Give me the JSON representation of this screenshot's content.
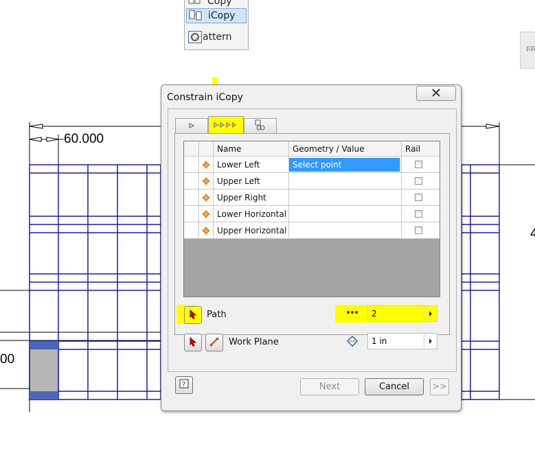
{
  "context_menu": {
    "items": [
      {
        "label": "Copy",
        "icon": "copy-icon"
      },
      {
        "label": "iCopy",
        "icon": "icopy-icon",
        "selected": true
      },
      {
        "label": "attern",
        "icon": "pattern-icon"
      }
    ]
  },
  "badge": {
    "text": "FR"
  },
  "drawing": {
    "dimension_label": "60.000",
    "dimension_label_partial_left": "00",
    "dimension_label_partial_right": "4",
    "line_color": "#1b1b9e"
  },
  "dialog": {
    "title": "Constrain iCopy",
    "tabs": [
      {
        "name": "tab-start",
        "icon": "start-point-icon"
      },
      {
        "name": "tab-path",
        "icon": "path-points-icon",
        "active": true,
        "highlight": "#ffff00"
      },
      {
        "name": "tab-links",
        "icon": "link-icon"
      }
    ],
    "table": {
      "headers": {
        "name": "Name",
        "geometry": "Geometry / Value",
        "rail": "Rail"
      },
      "rows": [
        {
          "name": "Lower Left",
          "geometry": "Select point",
          "rail": false,
          "selected": true
        },
        {
          "name": "Upper Left",
          "geometry": "",
          "rail": false
        },
        {
          "name": "Upper Right",
          "geometry": "",
          "rail": false
        },
        {
          "name": "Lower Horizontal",
          "geometry": "",
          "rail": false
        },
        {
          "name": "Upper Horizontal",
          "geometry": "",
          "rail": false
        }
      ]
    },
    "path": {
      "label": "Path",
      "count_value": "2"
    },
    "work_plane": {
      "label": "Work Plane",
      "offset_value": "1 in"
    },
    "buttons": {
      "next": "Next",
      "cancel": "Cancel",
      "more": ">>"
    }
  },
  "colors": {
    "highlight": "#ffff00",
    "selection": "#3399ff",
    "constraint_icon": "#e07000"
  }
}
